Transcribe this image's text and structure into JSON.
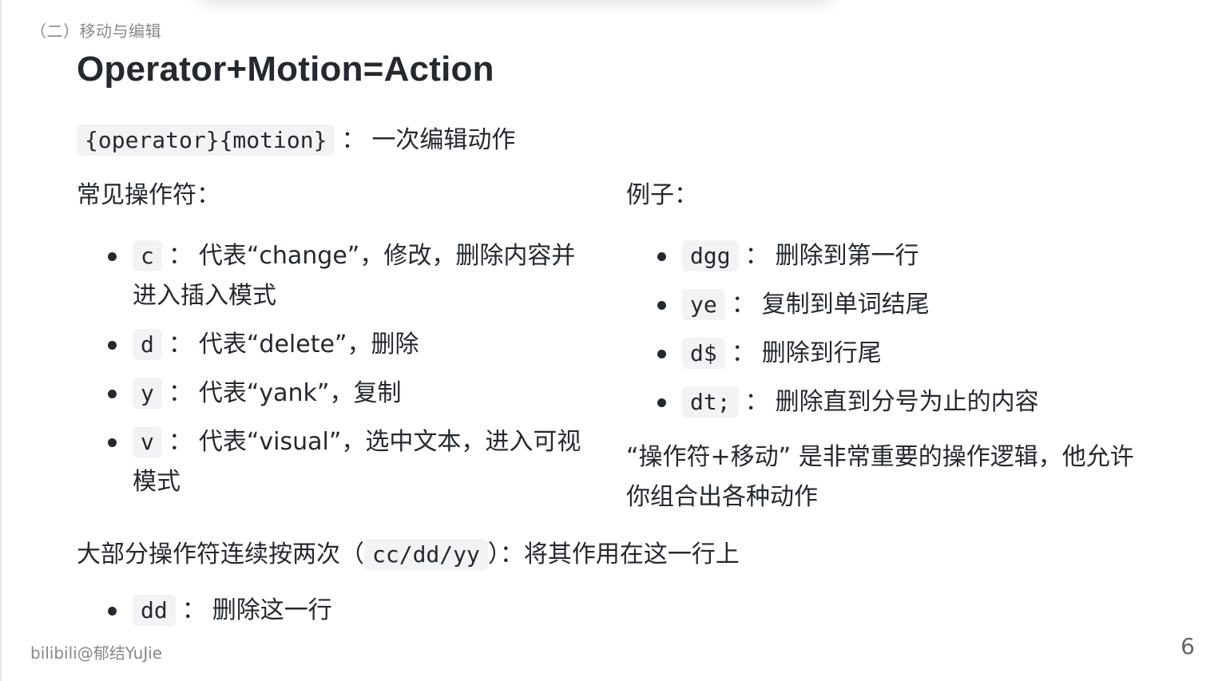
{
  "section_label": "（二）移动与编辑",
  "title": "Operator+Motion=Action",
  "intro": {
    "code": "{operator}{motion}",
    "colon": "：",
    "text": "一次编辑动作"
  },
  "operators": {
    "heading": "常见操作符：",
    "items": [
      {
        "code": "c",
        "colon": "：",
        "text": "代表“change”，修改，删除内容并进入插入模式"
      },
      {
        "code": "d",
        "colon": "：",
        "text": "代表“delete”，删除"
      },
      {
        "code": "y",
        "colon": "：",
        "text": "代表“yank”，复制"
      },
      {
        "code": "v",
        "colon": "：",
        "text": "代表“visual”，选中文本，进入可视模式"
      }
    ]
  },
  "examples": {
    "heading": "例子：",
    "items": [
      {
        "code": "dgg",
        "colon": "：",
        "text": "删除到第一行"
      },
      {
        "code": "ye",
        "colon": "：",
        "text": "复制到单词结尾"
      },
      {
        "code": "d$",
        "colon": "：",
        "text": "删除到行尾"
      },
      {
        "code": "dt;",
        "colon": "：",
        "text": "删除直到分号为止的内容"
      }
    ],
    "note": "“操作符+移动” 是非常重要的操作逻辑，他允许你组合出各种动作"
  },
  "double_press": {
    "prefix": "大部分操作符连续按两次（",
    "code": "cc/dd/yy",
    "suffix": "）：将其作用在这一行上",
    "items": [
      {
        "code": "dd",
        "colon": "：",
        "text": "删除这一行"
      }
    ]
  },
  "footer": {
    "credit": "bilibili@郁结YuJie",
    "page_number": "6"
  }
}
